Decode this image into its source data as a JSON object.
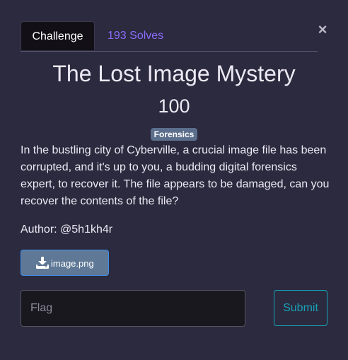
{
  "modal": {
    "close_label": "×",
    "tabs": [
      {
        "label": "Challenge",
        "active": true
      },
      {
        "label": "193 Solves",
        "active": false
      }
    ],
    "title": "The Lost Image Mystery",
    "points": "100",
    "category_tag": "Forensics",
    "description": "In the bustling city of Cyberville, a crucial image file has been corrupted, and it's up to you, a budding digital forensics expert, to recover it. The file appears to be damaged, can you recover the contents of the file?",
    "author": "Author: @5h1kh4r",
    "file": {
      "icon": "download-icon",
      "label": "image.png"
    },
    "flag_input": {
      "placeholder": "Flag",
      "value": ""
    },
    "submit_label": "Submit"
  },
  "colors": {
    "background": "#2c2a3e",
    "active_tab": "#121016",
    "solves_link": "#8a6cff",
    "tag": "#5b6e8c",
    "file_button": "#5f7896",
    "submit_outline": "#17a2b8"
  }
}
